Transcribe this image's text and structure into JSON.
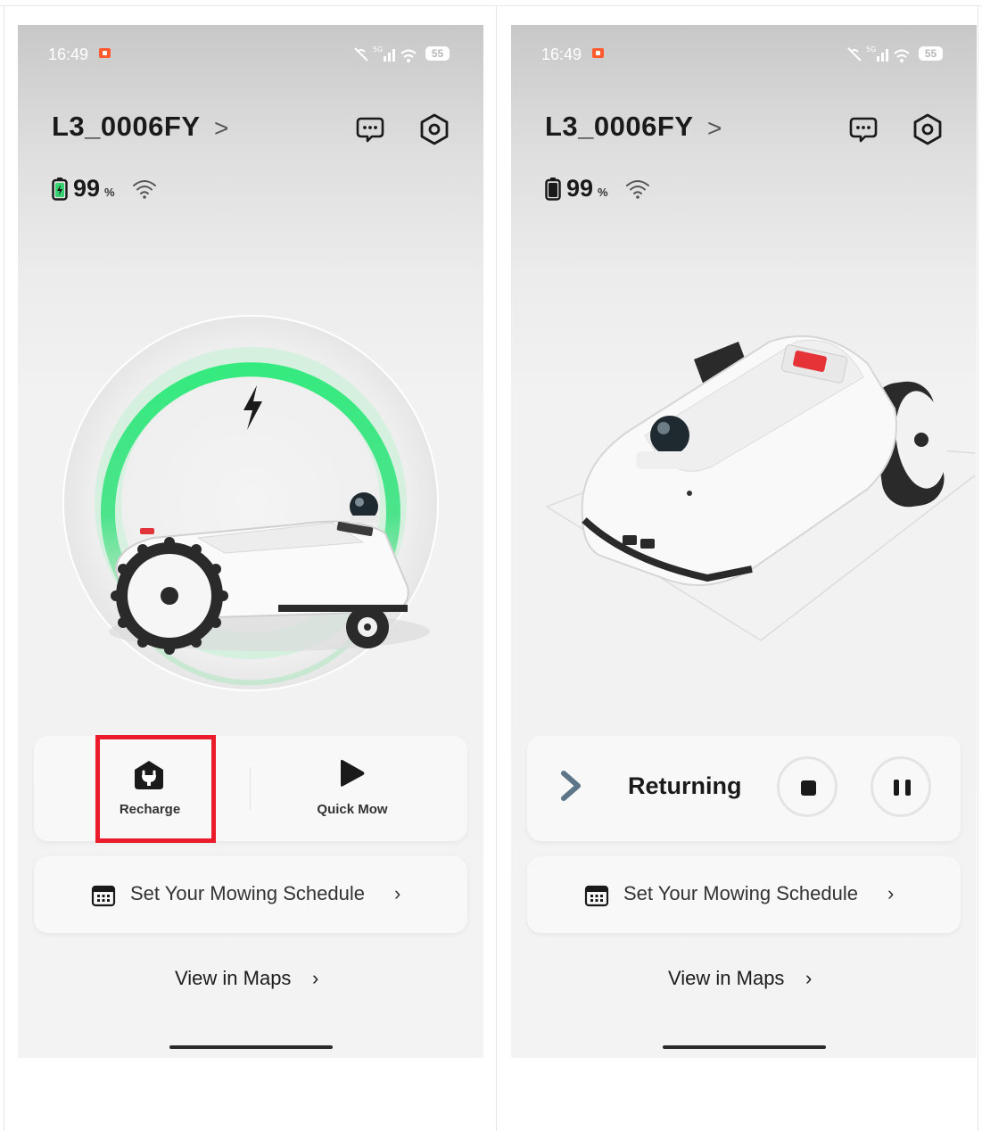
{
  "screens": [
    {
      "status_time": "16:49",
      "status_battery": "55",
      "device_name": "L3_0006FY",
      "battery_percent": "99",
      "battery_unit": "%",
      "state": "charging",
      "actions": [
        {
          "label": "Recharge",
          "icon": "recharge-icon"
        },
        {
          "label": "Quick Mow",
          "icon": "play-icon"
        }
      ],
      "schedule_label": "Set Your Mowing Schedule",
      "maps_label": "View in Maps"
    },
    {
      "status_time": "16:49",
      "status_battery": "55",
      "device_name": "L3_0006FY",
      "battery_percent": "99",
      "battery_unit": "%",
      "state": "returning",
      "status_label": "Returning",
      "controls": [
        {
          "icon": "stop-icon"
        },
        {
          "icon": "pause-icon"
        }
      ],
      "schedule_label": "Set Your Mowing Schedule",
      "maps_label": "View in Maps"
    }
  ],
  "colors": {
    "highlight": "#ea1c2b",
    "charge_green": "#3ce07a",
    "status_rec": "#ff5b2e"
  },
  "chevron": "›",
  "chevron_title": ">"
}
